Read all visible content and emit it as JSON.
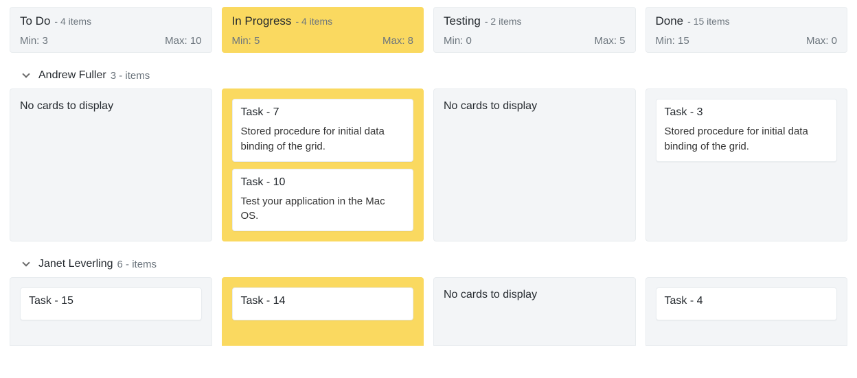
{
  "columns": [
    {
      "title": "To Do",
      "count": "- 4 items",
      "min": "Min: 3",
      "max": "Max: 10",
      "highlight": false
    },
    {
      "title": "In Progress",
      "count": "- 4 items",
      "min": "Min: 5",
      "max": "Max: 8",
      "highlight": true
    },
    {
      "title": "Testing",
      "count": "- 2 items",
      "min": "Min: 0",
      "max": "Max: 5",
      "highlight": false
    },
    {
      "title": "Done",
      "count": "- 15 items",
      "min": "Min: 15",
      "max": "Max: 0",
      "highlight": false
    }
  ],
  "swimlanes": [
    {
      "name": "Andrew Fuller",
      "info": "3 - items",
      "cells": [
        {
          "empty": "No cards to display"
        },
        {
          "cards": [
            {
              "title": "Task - 7",
              "body": "Stored procedure for initial data binding of the grid."
            },
            {
              "title": "Task - 10",
              "body": "Test your application in the Mac OS."
            }
          ]
        },
        {
          "empty": "No cards to display"
        },
        {
          "cards": [
            {
              "title": "Task - 3",
              "body": "Stored procedure for initial data binding of the grid."
            }
          ]
        }
      ]
    },
    {
      "name": "Janet Leverling",
      "info": "6 - items",
      "cells": [
        {
          "cards": [
            {
              "title": "Task - 15",
              "body": ""
            }
          ]
        },
        {
          "cards": [
            {
              "title": "Task - 14",
              "body": ""
            }
          ]
        },
        {
          "empty": "No cards to display"
        },
        {
          "cards": [
            {
              "title": "Task - 4",
              "body": ""
            }
          ]
        }
      ]
    }
  ]
}
